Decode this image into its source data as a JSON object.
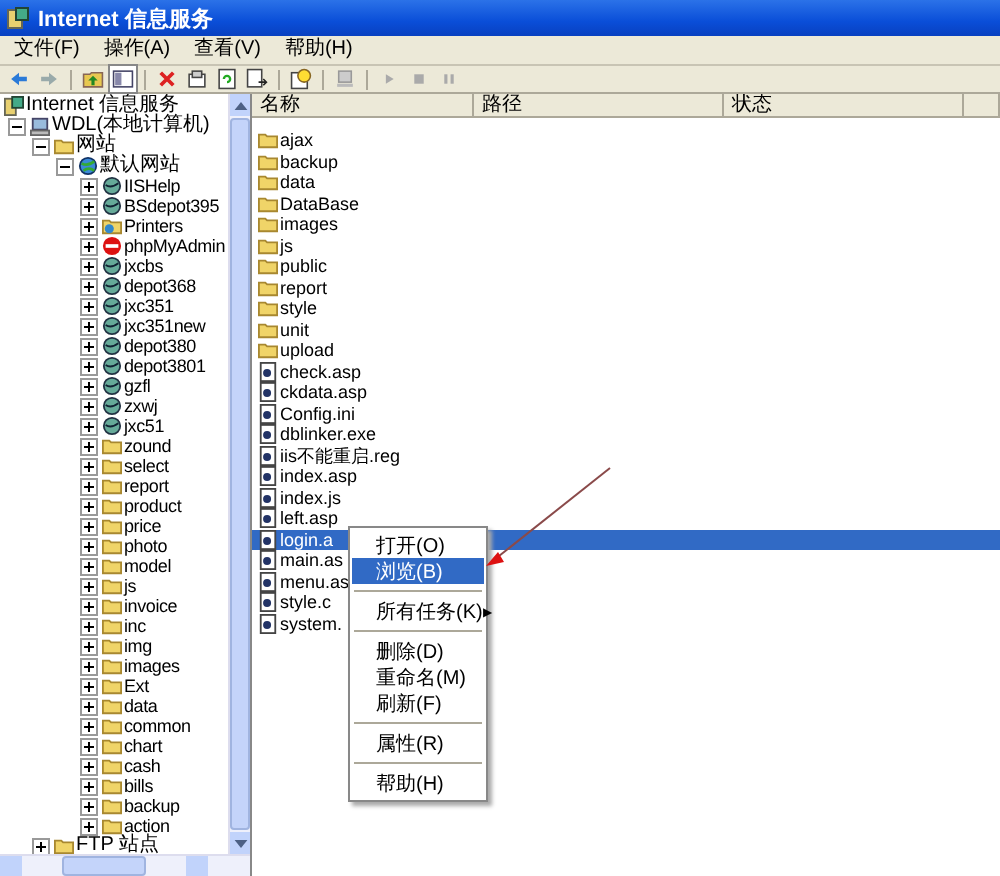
{
  "window": {
    "title": "Internet 信息服务"
  },
  "menu": [
    "文件(F)",
    "操作(A)",
    "查看(V)",
    "帮助(H)"
  ],
  "tree": [
    {
      "label": "Internet 信息服务",
      "kind": "services",
      "children": [
        {
          "label": "WDL(本地计算机)",
          "kind": "computer",
          "expanded": true,
          "children": [
            {
              "label": "网站",
              "kind": "folder",
              "expanded": true,
              "children": [
                {
                  "label": "默认网站",
                  "kind": "site",
                  "expanded": true,
                  "children": [
                    {
                      "label": "IISHelp",
                      "kind": "app",
                      "expanded": false
                    },
                    {
                      "label": "BSdepot395",
                      "kind": "app",
                      "expanded": false
                    },
                    {
                      "label": "Printers",
                      "kind": "vdir",
                      "expanded": false
                    },
                    {
                      "label": "phpMyAdmin",
                      "kind": "stopped",
                      "expanded": false
                    },
                    {
                      "label": "jxcbs",
                      "kind": "app",
                      "expanded": false
                    },
                    {
                      "label": "depot368",
                      "kind": "app",
                      "expanded": false
                    },
                    {
                      "label": "jxc351",
                      "kind": "app",
                      "expanded": false
                    },
                    {
                      "label": "jxc351new",
                      "kind": "app",
                      "expanded": false
                    },
                    {
                      "label": "depot380",
                      "kind": "app",
                      "expanded": false
                    },
                    {
                      "label": "depot3801",
                      "kind": "app",
                      "expanded": false
                    },
                    {
                      "label": "gzfl",
                      "kind": "app",
                      "expanded": false
                    },
                    {
                      "label": "zxwj",
                      "kind": "app",
                      "expanded": false
                    },
                    {
                      "label": "jxc51",
                      "kind": "app",
                      "expanded": false
                    },
                    {
                      "label": "zound",
                      "kind": "folder",
                      "expanded": false
                    },
                    {
                      "label": "select",
                      "kind": "folder",
                      "expanded": false
                    },
                    {
                      "label": "report",
                      "kind": "folder",
                      "expanded": false
                    },
                    {
                      "label": "product",
                      "kind": "folder",
                      "expanded": false
                    },
                    {
                      "label": "price",
                      "kind": "folder",
                      "expanded": false
                    },
                    {
                      "label": "photo",
                      "kind": "folder",
                      "expanded": false
                    },
                    {
                      "label": "model",
                      "kind": "folder",
                      "expanded": false
                    },
                    {
                      "label": "js",
                      "kind": "folder",
                      "expanded": false
                    },
                    {
                      "label": "invoice",
                      "kind": "folder",
                      "expanded": false
                    },
                    {
                      "label": "inc",
                      "kind": "folder",
                      "expanded": false
                    },
                    {
                      "label": "img",
                      "kind": "folder",
                      "expanded": false
                    },
                    {
                      "label": "images",
                      "kind": "folder",
                      "expanded": false
                    },
                    {
                      "label": "Ext",
                      "kind": "folder",
                      "expanded": false
                    },
                    {
                      "label": "data",
                      "kind": "folder",
                      "expanded": false
                    },
                    {
                      "label": "common",
                      "kind": "folder",
                      "expanded": false
                    },
                    {
                      "label": "chart",
                      "kind": "folder",
                      "expanded": false
                    },
                    {
                      "label": "cash",
                      "kind": "folder",
                      "expanded": false
                    },
                    {
                      "label": "bills",
                      "kind": "folder",
                      "expanded": false
                    },
                    {
                      "label": "backup",
                      "kind": "folder",
                      "expanded": false
                    },
                    {
                      "label": "action",
                      "kind": "folder",
                      "expanded": false
                    }
                  ]
                }
              ]
            },
            {
              "label": "FTP 站点",
              "kind": "folder",
              "expanded": false
            }
          ]
        }
      ]
    }
  ],
  "list": {
    "columns": [
      "名称",
      "路径",
      "状态"
    ],
    "rows": [
      {
        "name": "ajax",
        "kind": "folder",
        "selected": false
      },
      {
        "name": "backup",
        "kind": "folder",
        "selected": false
      },
      {
        "name": "data",
        "kind": "folder",
        "selected": false
      },
      {
        "name": "DataBase",
        "kind": "folder",
        "selected": false
      },
      {
        "name": "images",
        "kind": "folder",
        "selected": false
      },
      {
        "name": "js",
        "kind": "folder",
        "selected": false
      },
      {
        "name": "public",
        "kind": "folder",
        "selected": false
      },
      {
        "name": "report",
        "kind": "folder",
        "selected": false
      },
      {
        "name": "style",
        "kind": "folder",
        "selected": false
      },
      {
        "name": "unit",
        "kind": "folder",
        "selected": false
      },
      {
        "name": "upload",
        "kind": "folder",
        "selected": false
      },
      {
        "name": "check.asp",
        "kind": "file",
        "selected": false
      },
      {
        "name": "ckdata.asp",
        "kind": "file",
        "selected": false
      },
      {
        "name": "Config.ini",
        "kind": "file",
        "selected": false
      },
      {
        "name": "dblinker.exe",
        "kind": "file",
        "selected": false
      },
      {
        "name": "iis不能重启.reg",
        "kind": "file",
        "selected": false
      },
      {
        "name": "index.asp",
        "kind": "file",
        "selected": false
      },
      {
        "name": "index.js",
        "kind": "file",
        "selected": false
      },
      {
        "name": "left.asp",
        "kind": "file",
        "selected": false
      },
      {
        "name": "login.a",
        "kind": "file",
        "selected": true
      },
      {
        "name": "main.as",
        "kind": "file",
        "selected": false
      },
      {
        "name": "menu.as",
        "kind": "file",
        "selected": false
      },
      {
        "name": "style.c",
        "kind": "file",
        "selected": false
      },
      {
        "name": "system.",
        "kind": "file",
        "selected": false
      }
    ]
  },
  "context_menu": [
    {
      "kind": "item",
      "label": "打开(O)",
      "selected": false
    },
    {
      "kind": "item",
      "label": "浏览(B)",
      "selected": true
    },
    {
      "kind": "separator"
    },
    {
      "kind": "submenu",
      "label": "所有任务(K)",
      "arrow": "▶",
      "selected": false
    },
    {
      "kind": "separator"
    },
    {
      "kind": "item",
      "label": "删除(D)",
      "selected": false
    },
    {
      "kind": "item",
      "label": "重命名(M)",
      "selected": false
    },
    {
      "kind": "item",
      "label": "刷新(F)",
      "selected": false
    },
    {
      "kind": "separator"
    },
    {
      "kind": "item",
      "label": "属性(R)",
      "selected": false
    },
    {
      "kind": "separator"
    },
    {
      "kind": "item",
      "label": "帮助(H)",
      "selected": false
    }
  ]
}
